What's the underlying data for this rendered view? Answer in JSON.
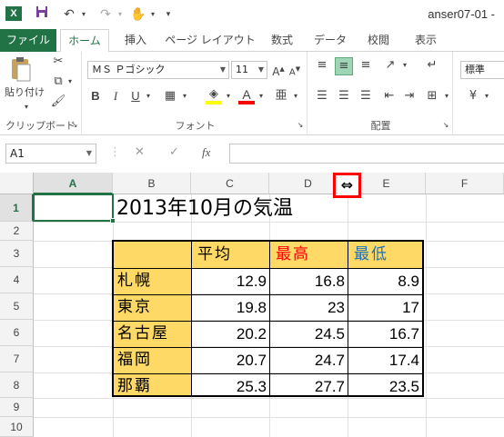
{
  "titlebar": {
    "app_logo": "X",
    "window_title": "anser07-01 -",
    "quick_access": [
      "save-icon",
      "undo-icon",
      "redo-icon",
      "touch-mode-icon",
      "customize-icon"
    ]
  },
  "ribbon_tabs": [
    "ファイル",
    "ホーム",
    "挿入",
    "ページ レイアウト",
    "数式",
    "データ",
    "校閲",
    "表示"
  ],
  "active_tab": "ホーム",
  "ribbon": {
    "clipboard": {
      "paste_label": "貼り付け",
      "group_label": "クリップボード"
    },
    "font": {
      "font_name": "ＭＳ Ｐゴシック",
      "font_size": "11",
      "group_label": "フォント",
      "bold": "B",
      "italic": "I",
      "underline": "U",
      "font_color": "#ff0000",
      "fill_color": "#ffff00"
    },
    "alignment": {
      "group_label": "配置"
    },
    "number": {
      "format": "標準"
    }
  },
  "formula_bar": {
    "name_box": "A1",
    "fx": "fx",
    "cancel": "✕",
    "enter": "✓",
    "value": ""
  },
  "columns": [
    "A",
    "B",
    "C",
    "D",
    "E",
    "F"
  ],
  "selected_column": "A",
  "rows": [
    "1",
    "2",
    "3",
    "4",
    "5",
    "6",
    "7",
    "8",
    "9",
    "10"
  ],
  "selected_row": "1",
  "resize_cursor": "⇔",
  "sheet": {
    "title": "2013年10月の気温",
    "headers": {
      "avg": "平均",
      "max": "最高",
      "min": "最低"
    },
    "header_colors": {
      "avg": "#000000",
      "max": "#ff0000",
      "min": "#1f6fb5"
    },
    "header_fill": "#ffd966",
    "table": [
      {
        "city": "札幌",
        "avg": "12.9",
        "max": "16.8",
        "min": "8.9"
      },
      {
        "city": "東京",
        "avg": "19.8",
        "max": "23",
        "min": "17"
      },
      {
        "city": "名古屋",
        "avg": "20.2",
        "max": "24.5",
        "min": "16.7"
      },
      {
        "city": "福岡",
        "avg": "20.7",
        "max": "24.7",
        "min": "17.4"
      },
      {
        "city": "那覇",
        "avg": "25.3",
        "max": "27.7",
        "min": "23.5"
      }
    ]
  },
  "accent_color": "#217346",
  "highlight_color": "#ff0000"
}
